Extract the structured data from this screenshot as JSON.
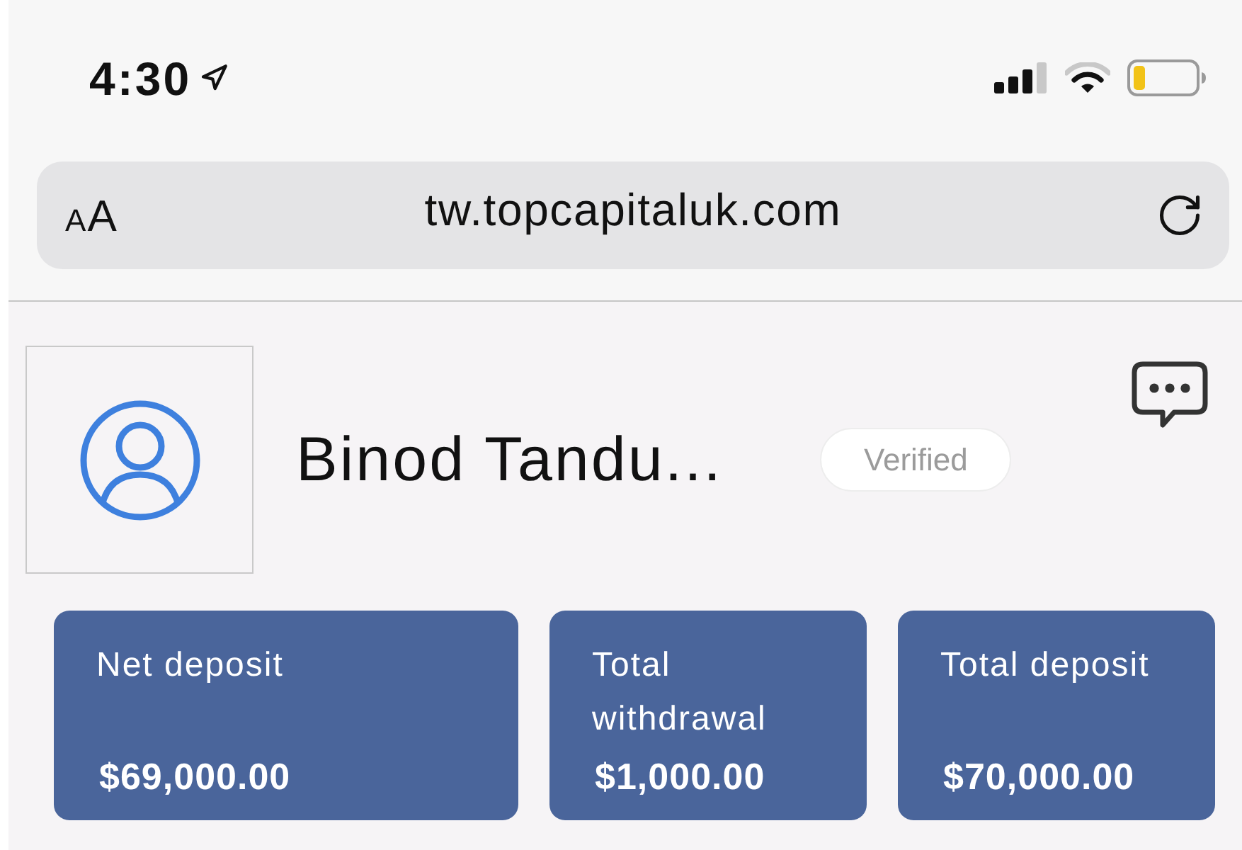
{
  "status_bar": {
    "time": "4:30"
  },
  "address_bar": {
    "text_size_button": "AA",
    "url": "tw.topcapitaluk.com"
  },
  "profile": {
    "name": "Binod Tandu...",
    "badge": "Verified"
  },
  "stats": [
    {
      "label": "Net deposit",
      "value": "$69,000.00"
    },
    {
      "label": "Total withdrawal",
      "value": "$1,000.00"
    },
    {
      "label": "Total deposit",
      "value": "$70,000.00"
    }
  ]
}
